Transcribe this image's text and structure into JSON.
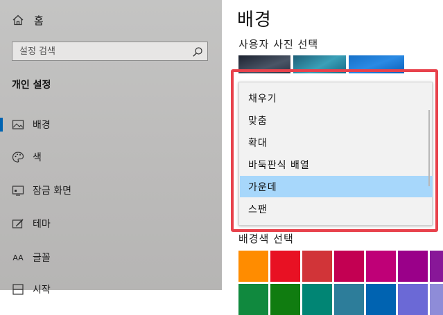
{
  "sidebar": {
    "home_label": "홈",
    "search_placeholder": "설정 검색",
    "section_title": "개인 설정",
    "items": [
      {
        "label": "배경",
        "icon": "image-icon",
        "active": true
      },
      {
        "label": "색",
        "icon": "palette-icon",
        "active": false
      },
      {
        "label": "잠금 화면",
        "icon": "lock-screen-icon",
        "active": false
      },
      {
        "label": "테마",
        "icon": "theme-brush-icon",
        "active": false
      },
      {
        "label": "글꼴",
        "icon": "font-icon",
        "font_glyph": "AA",
        "active": false
      },
      {
        "label": "시작",
        "icon": "start-icon",
        "active": false
      }
    ]
  },
  "main": {
    "page_title": "배경",
    "choose_picture_label": "사용자 사진 선택",
    "fit_options": [
      "채우기",
      "맞춤",
      "확대",
      "바둑판식 배열",
      "가운데",
      "스팬"
    ],
    "selected_fit": "가운데",
    "background_color_label": "배경색 선택",
    "swatch_colors": [
      "#ff8c00",
      "#e81123",
      "#d13438",
      "#c30052",
      "#bf0077",
      "#9a0089",
      "#881798"
    ],
    "swatch_colors_row2": [
      "#10893e",
      "#107c10",
      "#018574",
      "#2d7d9a",
      "#0063b1",
      "#6b69d6",
      "#8e8cd8"
    ]
  },
  "colors": {
    "accent": "#0063b1",
    "selected_item_bg": "#a7d7fb",
    "highlight_frame": "#e8424c"
  }
}
